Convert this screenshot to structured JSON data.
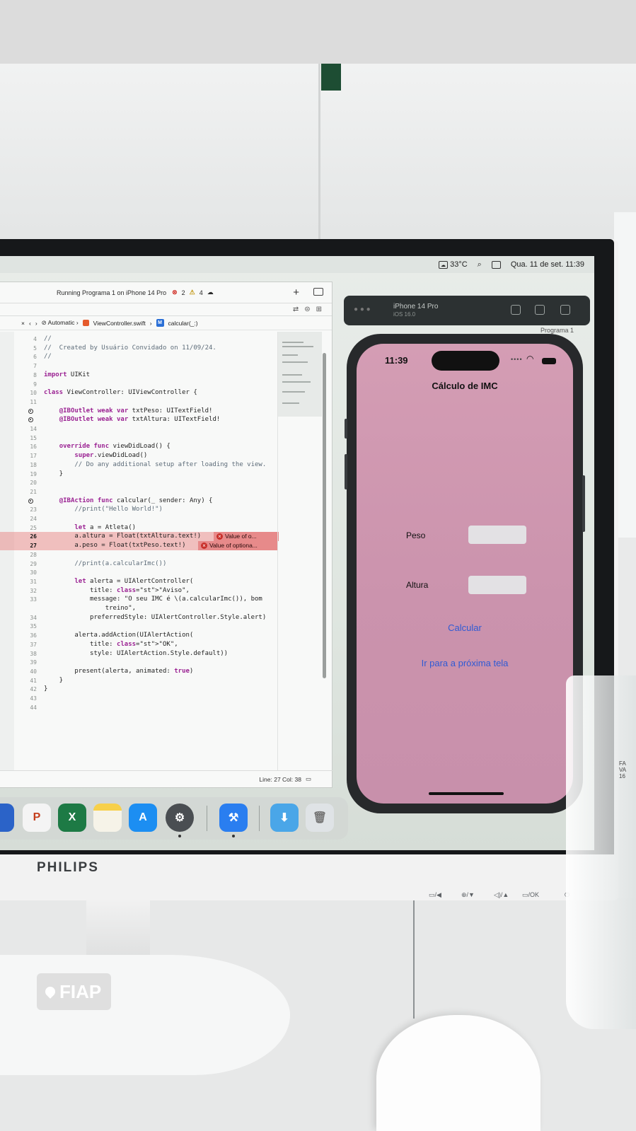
{
  "menubar": {
    "temperature": "33°C",
    "datetime": "Qua. 11 de set.  11:39"
  },
  "xcode": {
    "status_text": "Running Programa 1 on iPhone 14 Pro",
    "error_count": "2",
    "warning_count": "4",
    "jumpbar": {
      "scheme_mode": "Automatic",
      "file": "ViewController.swift",
      "method": "calcular(_:)"
    },
    "code_lines": [
      {
        "n": "4",
        "text": "//"
      },
      {
        "n": "5",
        "text": "//  Created by Usuário Convidado on 11/09/24."
      },
      {
        "n": "6",
        "text": "//"
      },
      {
        "n": "7",
        "text": ""
      },
      {
        "n": "8",
        "text": "import UIKit"
      },
      {
        "n": "9",
        "text": ""
      },
      {
        "n": "10",
        "text": "class ViewController: UIViewController {"
      },
      {
        "n": "11",
        "text": ""
      },
      {
        "n": "",
        "text": "    @IBOutlet weak var txtPeso: UITextField!"
      },
      {
        "n": "",
        "text": "    @IBOutlet weak var txtAltura: UITextField!"
      },
      {
        "n": "14",
        "text": ""
      },
      {
        "n": "15",
        "text": ""
      },
      {
        "n": "16",
        "text": "    override func viewDidLoad() {"
      },
      {
        "n": "17",
        "text": "        super.viewDidLoad()"
      },
      {
        "n": "18",
        "text": "        // Do any additional setup after loading the view."
      },
      {
        "n": "19",
        "text": "    }"
      },
      {
        "n": "20",
        "text": ""
      },
      {
        "n": "21",
        "text": ""
      },
      {
        "n": "",
        "text": "    @IBAction func calcular(_ sender: Any) {"
      },
      {
        "n": "23",
        "text": "        //print(\"Hello World!\")"
      },
      {
        "n": "24",
        "text": ""
      },
      {
        "n": "25",
        "text": "        let a = Atleta()"
      },
      {
        "n": "26",
        "text": "        a.altura = Float(txtAltura.text!)"
      },
      {
        "n": "27",
        "text": "        a.peso = Float(txtPeso.text!)"
      },
      {
        "n": "28",
        "text": ""
      },
      {
        "n": "29",
        "text": "        //print(a.calcularImc())"
      },
      {
        "n": "30",
        "text": ""
      },
      {
        "n": "31",
        "text": "        let alerta = UIAlertController("
      },
      {
        "n": "32",
        "text": "            title: \"Aviso\","
      },
      {
        "n": "33",
        "text": "            message: \"O seu IMC é \\(a.calcularImc()), bom"
      },
      {
        "n": "",
        "text": "                treino\","
      },
      {
        "n": "34",
        "text": "            preferredStyle: UIAlertController.Style.alert)"
      },
      {
        "n": "35",
        "text": ""
      },
      {
        "n": "36",
        "text": "        alerta.addAction(UIAlertAction("
      },
      {
        "n": "37",
        "text": "            title: \"OK\","
      },
      {
        "n": "38",
        "text": "            style: UIAlertAction.Style.default))"
      },
      {
        "n": "39",
        "text": ""
      },
      {
        "n": "40",
        "text": "        present(alerta, animated: true)"
      },
      {
        "n": "41",
        "text": "    }"
      },
      {
        "n": "42",
        "text": "}"
      },
      {
        "n": "43",
        "text": ""
      },
      {
        "n": "44",
        "text": ""
      }
    ],
    "error_1": "Value of o...",
    "error_2": "Value of optiona...",
    "cursor_position": "Line: 27  Col: 38"
  },
  "simulator": {
    "device_name": "iPhone 14 Pro",
    "device_os": "iOS 16.0",
    "app_label": "Programa 1"
  },
  "app": {
    "status_time": "11:39",
    "title": "Cálculo de IMC",
    "peso_label": "Peso",
    "altura_label": "Altura",
    "calcular_button": "Calcular",
    "next_screen_link": "Ir para a próxima tela"
  },
  "monitor": {
    "brand": "PHILIPS"
  },
  "location_tag": "FIAP",
  "colors": {
    "app_background": "#cf98b1",
    "link_blue": "#2f5ad4",
    "error_red": "#d23b33"
  }
}
